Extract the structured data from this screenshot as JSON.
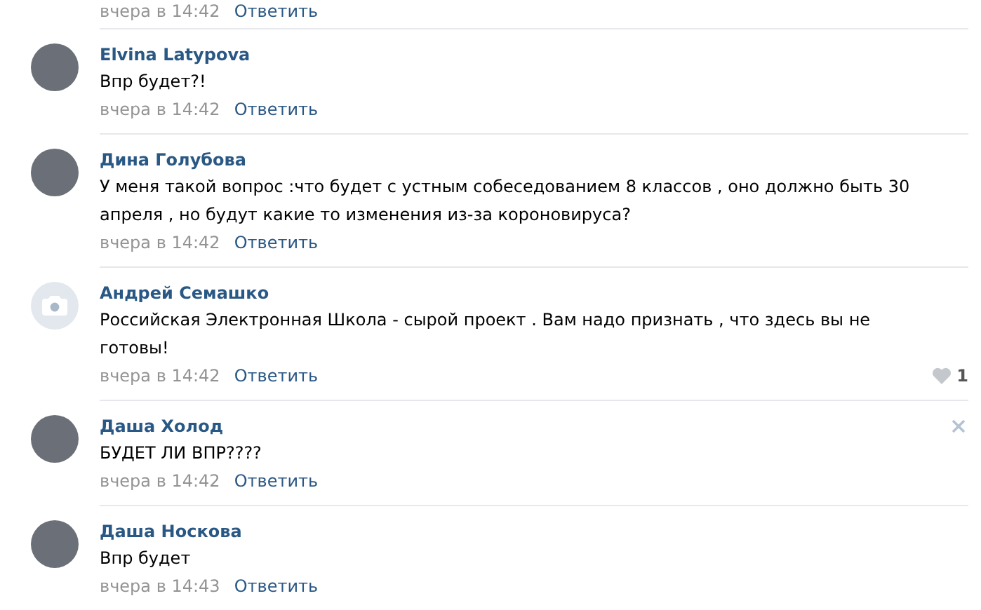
{
  "top_meta": {
    "time": "вчера в 14:42",
    "reply": "Ответить"
  },
  "comments": [
    {
      "author": "Elvina Latypova",
      "avatar": {
        "kind": "photo"
      },
      "text": "Впр будет?!",
      "time": "вчера в 14:42",
      "reply": "Ответить",
      "hovered": false
    },
    {
      "author": "Дина Голубова",
      "avatar": {
        "kind": "photo"
      },
      "text": "У меня такой вопрос :что будет с устным собеседованием 8 классов , оно должно быть 30 апреля , но будут какие то изменения из-за короновируса?",
      "time": "вчера в 14:42",
      "reply": "Ответить",
      "hovered": false
    },
    {
      "author": "Андрей Семашко",
      "avatar": {
        "kind": "camera"
      },
      "text": "Российская Электронная Школа - сырой проект . Вам надо признать , что здесь вы не готовы!",
      "time": "вчера в 14:42",
      "reply": "Ответить",
      "likes": "1",
      "hovered": false
    },
    {
      "author": "Даша Холод",
      "avatar": {
        "kind": "photo"
      },
      "text": "БУДЕТ ЛИ ВПР????",
      "time": "вчера в 14:42",
      "reply": "Ответить",
      "hovered": true
    },
    {
      "author": "Даша Носкова",
      "avatar": {
        "kind": "photo"
      },
      "text": "Впр будет",
      "time": "вчера в 14:43",
      "reply": "Ответить",
      "hovered": false
    }
  ]
}
